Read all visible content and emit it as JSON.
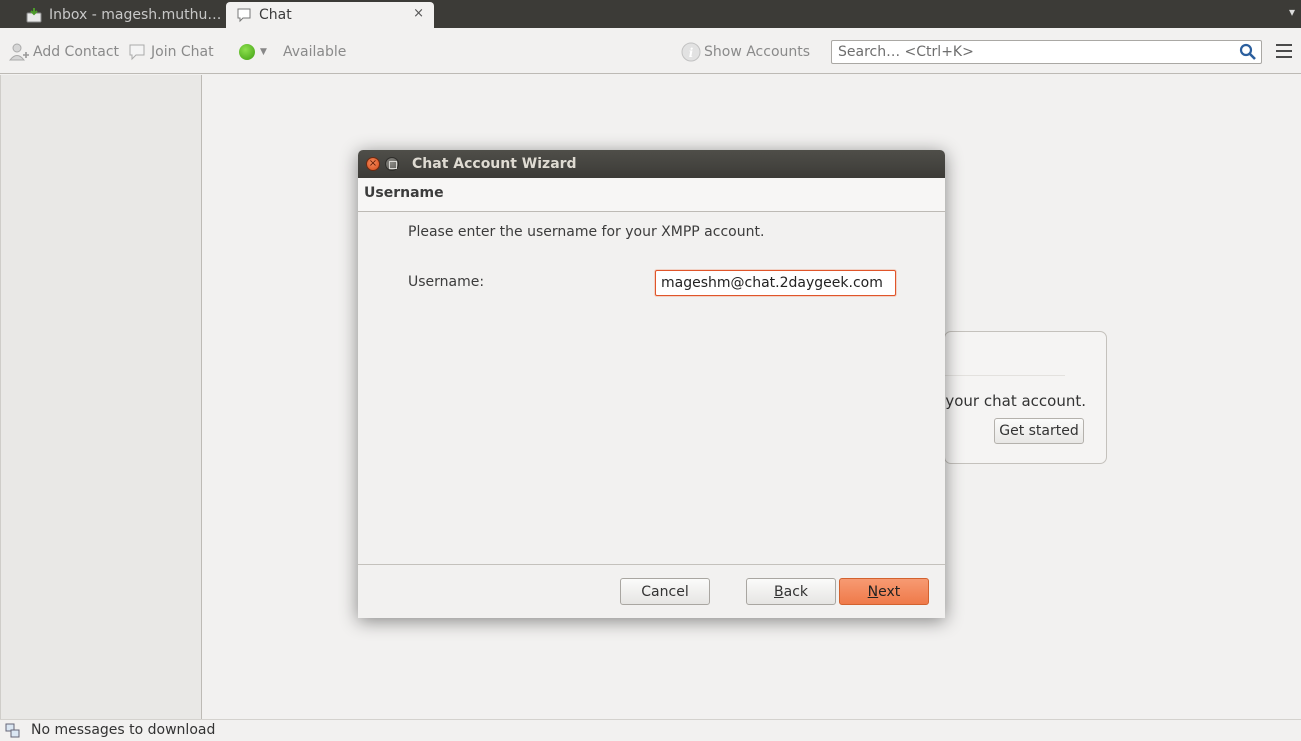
{
  "tabs": [
    {
      "label": "Inbox - magesh.muthu…",
      "icon": "mail-inbox-icon"
    },
    {
      "label": "Chat",
      "icon": "chat-bubble-icon",
      "close": "×"
    }
  ],
  "tab_menu": "▾",
  "toolbar": {
    "add_contact": "Add Contact",
    "join_chat": "Join Chat",
    "status": "Available",
    "show_accounts": "Show Accounts",
    "search_placeholder": "Search… <Ctrl+K>"
  },
  "get_started_card": {
    "text": "your chat account.",
    "button": "Get started"
  },
  "statusbar": {
    "text": "No messages to download"
  },
  "dialog": {
    "title": "Chat Account Wizard",
    "page_title": "Username",
    "instruction": "Please enter the username for your XMPP account.",
    "username_label": "Username:",
    "username_value": "mageshm@chat.2daygeek.com",
    "buttons": {
      "cancel": "Cancel",
      "back_accel": "B",
      "back_rest": "ack",
      "next_accel": "N",
      "next_rest": "ext"
    }
  },
  "colors": {
    "accent": "#ef7a4a",
    "tabbar": "#3c3b37",
    "window_bg": "#f2f1f0",
    "status_available": "#4caf1f"
  }
}
